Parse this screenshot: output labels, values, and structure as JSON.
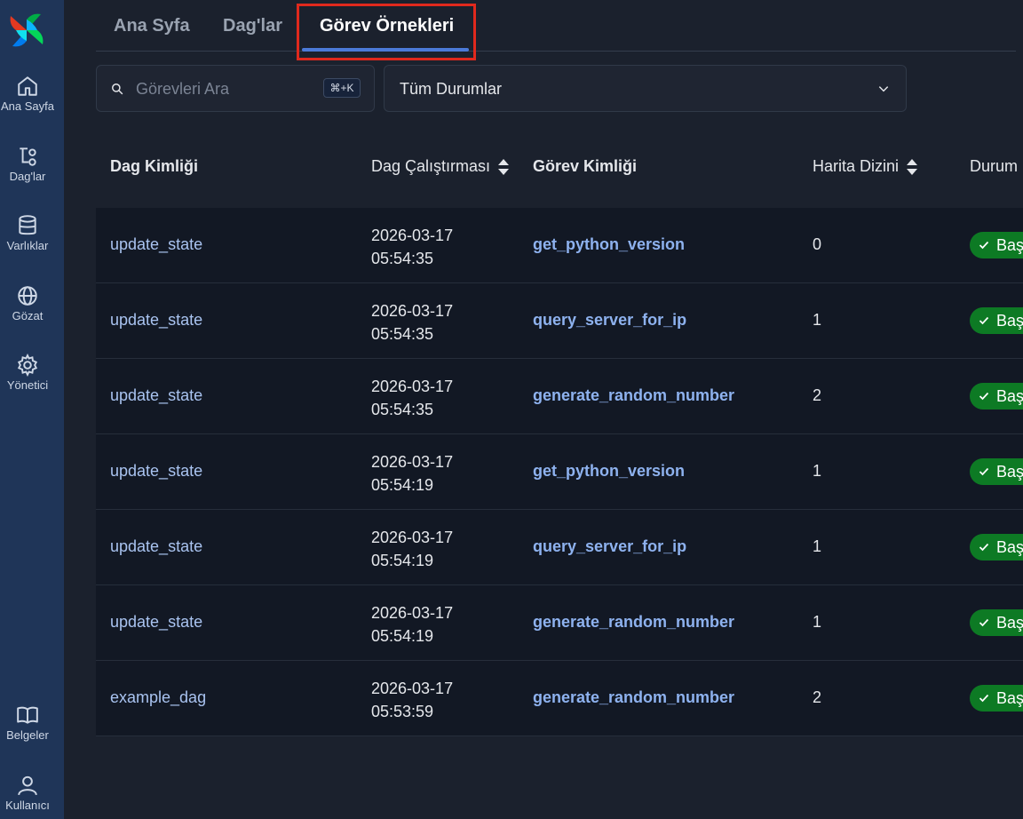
{
  "sidebar": {
    "items": [
      {
        "label": "Ana Sayfa",
        "icon": "home-icon"
      },
      {
        "label": "Dag'lar",
        "icon": "dag-icon"
      },
      {
        "label": "Varlıklar",
        "icon": "database-icon"
      },
      {
        "label": "Gözat",
        "icon": "globe-icon"
      },
      {
        "label": "Yönetici",
        "icon": "gear-icon"
      },
      {
        "label": "Belgeler",
        "icon": "book-icon"
      },
      {
        "label": "Kullanıcı",
        "icon": "user-icon"
      }
    ]
  },
  "tabs": [
    {
      "label": "Ana Syfa"
    },
    {
      "label": "Dag'lar"
    },
    {
      "label": "Görev Örnekleri",
      "active": true
    }
  ],
  "search": {
    "placeholder": "Görevleri Ara",
    "value": "",
    "shortcut": "⌘+K"
  },
  "status_filter": {
    "selected": "Tüm Durumlar"
  },
  "table": {
    "headers": {
      "dag_id": "Dag Kimliği",
      "dag_run": "Dag Çalıştırması",
      "task_id": "Görev Kimliği",
      "map_index": "Harita Dizini",
      "state": "Durum"
    },
    "rows": [
      {
        "dag_id": "update_state",
        "run_date": "2026-03-17",
        "run_time": "05:54:35",
        "task_id": "get_python_version",
        "map_index": "0",
        "state": "Baş"
      },
      {
        "dag_id": "update_state",
        "run_date": "2026-03-17",
        "run_time": "05:54:35",
        "task_id": "query_server_for_ip",
        "map_index": "1",
        "state": "Baş"
      },
      {
        "dag_id": "update_state",
        "run_date": "2026-03-17",
        "run_time": "05:54:35",
        "task_id": "generate_random_number",
        "map_index": "2",
        "state": "Baş"
      },
      {
        "dag_id": "update_state",
        "run_date": "2026-03-17",
        "run_time": "05:54:19",
        "task_id": "get_python_version",
        "map_index": "1",
        "state": "Baş"
      },
      {
        "dag_id": "update_state",
        "run_date": "2026-03-17",
        "run_time": "05:54:19",
        "task_id": "query_server_for_ip",
        "map_index": "1",
        "state": "Baş"
      },
      {
        "dag_id": "update_state",
        "run_date": "2026-03-17",
        "run_time": "05:54:19",
        "task_id": "generate_random_number",
        "map_index": "1",
        "state": "Baş"
      },
      {
        "dag_id": "example_dag",
        "run_date": "2026-03-17",
        "run_time": "05:53:59",
        "task_id": "generate_random_number",
        "map_index": "2",
        "state": "Baş"
      }
    ]
  },
  "colors": {
    "sidebar": "#1f3558",
    "accent": "#4b7ad8",
    "success": "#0d7a24",
    "highlight": "#e0291d"
  }
}
